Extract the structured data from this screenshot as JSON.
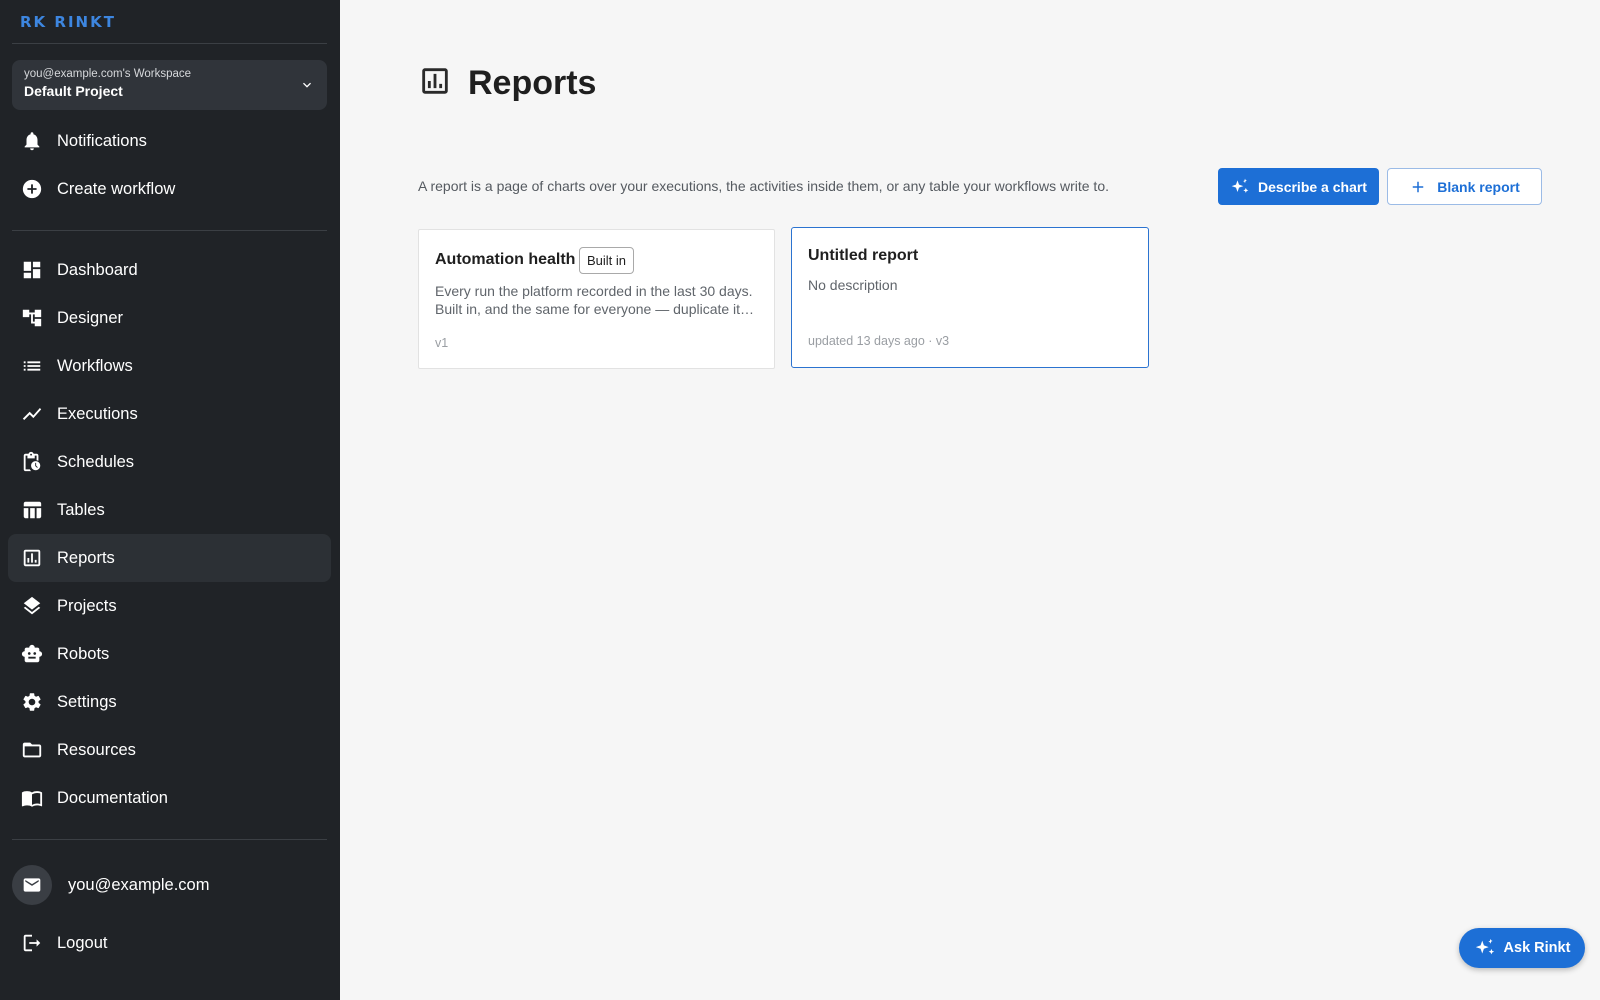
{
  "brand": {
    "name": "RK RINKT"
  },
  "workspace": {
    "owner": "you@example.com's Workspace",
    "project": "Default Project"
  },
  "sidebar": {
    "top_items": [
      {
        "label": "Notifications",
        "icon": "bell-icon"
      },
      {
        "label": "Create workflow",
        "icon": "plus-circle-icon"
      }
    ],
    "items": [
      {
        "label": "Dashboard",
        "icon": "dashboard-icon"
      },
      {
        "label": "Designer",
        "icon": "designer-icon"
      },
      {
        "label": "Workflows",
        "icon": "list-icon"
      },
      {
        "label": "Executions",
        "icon": "trend-icon"
      },
      {
        "label": "Schedules",
        "icon": "clipboard-clock-icon"
      },
      {
        "label": "Tables",
        "icon": "table-icon"
      },
      {
        "label": "Reports",
        "icon": "report-chart-icon",
        "active": true
      },
      {
        "label": "Projects",
        "icon": "layers-icon"
      },
      {
        "label": "Robots",
        "icon": "robot-icon"
      },
      {
        "label": "Settings",
        "icon": "gear-icon"
      },
      {
        "label": "Resources",
        "icon": "folder-icon"
      },
      {
        "label": "Documentation",
        "icon": "book-icon"
      }
    ],
    "user_email": "you@example.com",
    "logout_label": "Logout"
  },
  "main": {
    "title": "Reports",
    "description": "A report is a page of charts over your executions, the activities inside them, or any table your workflows write to.",
    "describe_button": "Describe a chart",
    "blank_button": "Blank report",
    "cards": [
      {
        "title": "Automation health",
        "badge": "Built in",
        "description_line1": "Every run the platform recorded in the last 30 days.",
        "description_line2": "Built in, and the same for everyone — duplicate it…",
        "meta": "v1"
      },
      {
        "title": "Untitled report",
        "description": "No description",
        "meta": "updated 13 days ago · v3"
      }
    ]
  },
  "fab": {
    "label": "Ask Rinkt"
  },
  "colors": {
    "sidebar_bg": "#202327",
    "accent": "#1d6fd6",
    "page_bg": "#f6f6f6"
  }
}
